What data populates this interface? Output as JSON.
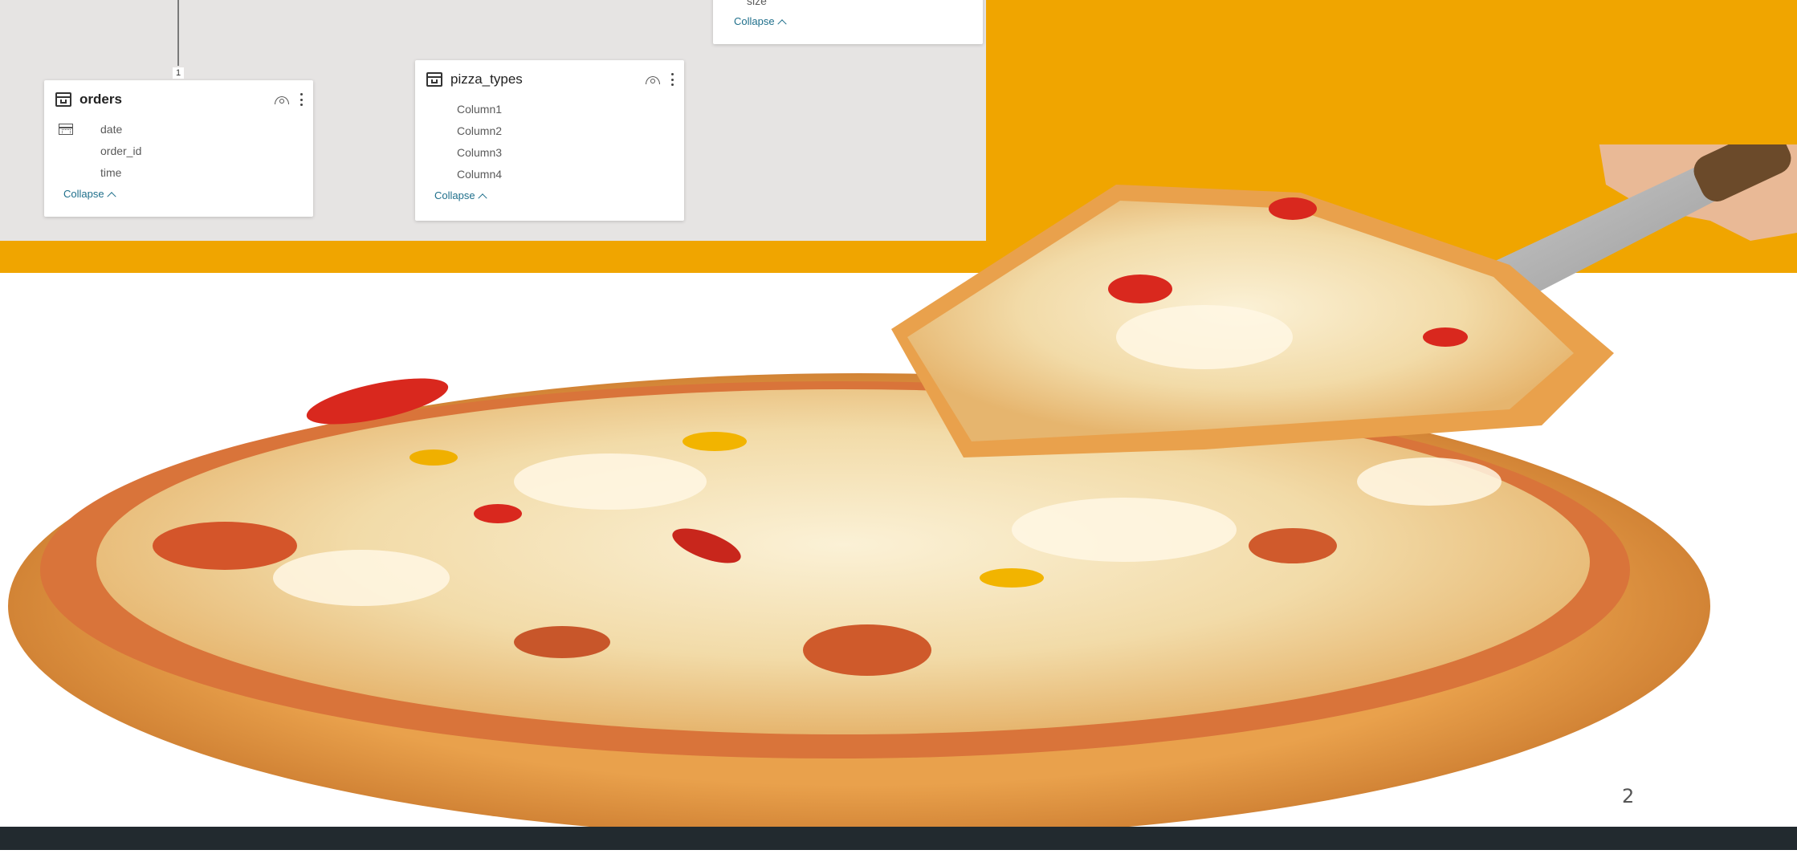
{
  "model_view": {
    "relationship_cardinality": "1",
    "tables": [
      {
        "name": "orders",
        "fields": [
          "date",
          "order_id",
          "time"
        ],
        "collapse_label": "Collapse"
      },
      {
        "name": "pizza_types",
        "fields": [
          "Column1",
          "Column2",
          "Column3",
          "Column4"
        ],
        "collapse_label": "Collapse"
      },
      {
        "name": "",
        "fields": [
          "size"
        ],
        "collapse_label": "Collapse"
      }
    ]
  },
  "slide": {
    "page_number": "2",
    "accent_color": "#F0A500",
    "footer_color": "#222A2F",
    "image": "pizza-slice-on-server"
  }
}
